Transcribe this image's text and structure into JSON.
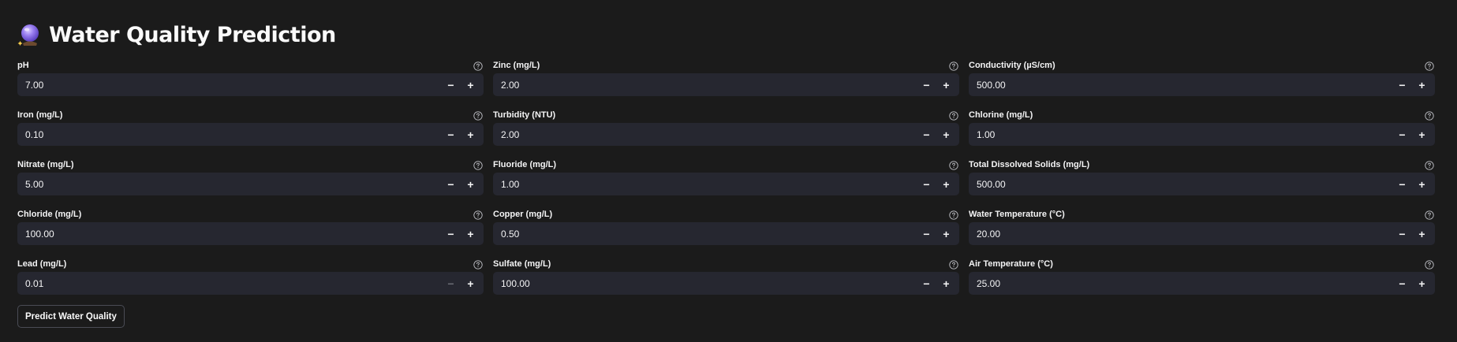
{
  "header": {
    "title": "Water Quality Prediction",
    "icon": "crystal-ball-icon"
  },
  "fields": [
    {
      "label": "pH",
      "value": "7.00",
      "minus_disabled": false
    },
    {
      "label": "Zinc (mg/L)",
      "value": "2.00",
      "minus_disabled": false
    },
    {
      "label": "Conductivity (µS/cm)",
      "value": "500.00",
      "minus_disabled": false
    },
    {
      "label": "Iron (mg/L)",
      "value": "0.10",
      "minus_disabled": false
    },
    {
      "label": "Turbidity (NTU)",
      "value": "2.00",
      "minus_disabled": false
    },
    {
      "label": "Chlorine (mg/L)",
      "value": "1.00",
      "minus_disabled": false
    },
    {
      "label": "Nitrate (mg/L)",
      "value": "5.00",
      "minus_disabled": false
    },
    {
      "label": "Fluoride (mg/L)",
      "value": "1.00",
      "minus_disabled": false
    },
    {
      "label": "Total Dissolved Solids (mg/L)",
      "value": "500.00",
      "minus_disabled": false
    },
    {
      "label": "Chloride (mg/L)",
      "value": "100.00",
      "minus_disabled": false
    },
    {
      "label": "Copper (mg/L)",
      "value": "0.50",
      "minus_disabled": false
    },
    {
      "label": "Water Temperature (°C)",
      "value": "20.00",
      "minus_disabled": false
    },
    {
      "label": "Lead (mg/L)",
      "value": "0.01",
      "minus_disabled": true
    },
    {
      "label": "Sulfate (mg/L)",
      "value": "100.00",
      "minus_disabled": false
    },
    {
      "label": "Air Temperature (°C)",
      "value": "25.00",
      "minus_disabled": false
    }
  ],
  "stepper": {
    "minus_symbol": "−",
    "plus_symbol": "+",
    "help_icon": "question-circle-icon"
  },
  "actions": {
    "predict_label": "Predict Water Quality"
  },
  "colors": {
    "background": "#1b1b1b",
    "input_background": "#262730",
    "text": "#f4f4f5",
    "disabled": "#6b6d75",
    "accent": "#8b6fe8"
  }
}
